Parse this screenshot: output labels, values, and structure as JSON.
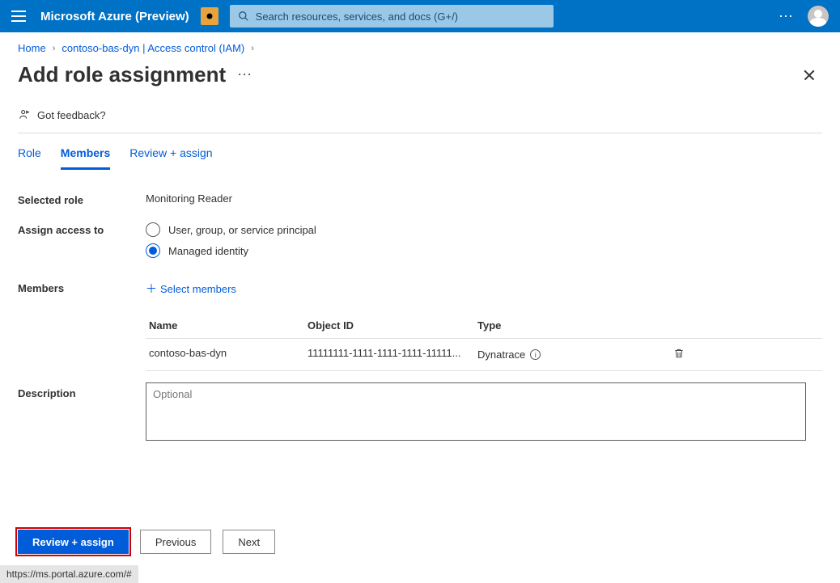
{
  "header": {
    "brand": "Microsoft Azure (Preview)",
    "search_placeholder": "Search resources, services, and docs (G+/)"
  },
  "breadcrumbs": {
    "items": [
      "Home",
      "contoso-bas-dyn | Access control (IAM)"
    ]
  },
  "page": {
    "title": "Add role assignment",
    "feedback": "Got feedback?"
  },
  "tabs": {
    "items": [
      {
        "label": "Role"
      },
      {
        "label": "Members"
      },
      {
        "label": "Review + assign"
      }
    ],
    "active_index": 1
  },
  "form": {
    "selected_role_label": "Selected role",
    "selected_role_value": "Monitoring Reader",
    "assign_access_label": "Assign access to",
    "assign_options": {
      "opt1": "User, group, or service principal",
      "opt2": "Managed identity"
    },
    "members_label": "Members",
    "select_members_link": "Select members",
    "table": {
      "headers": {
        "name": "Name",
        "object_id": "Object ID",
        "type": "Type"
      },
      "rows": [
        {
          "name": "contoso-bas-dyn",
          "object_id": "11111111-1111-1111-1111-11111...",
          "type": "Dynatrace"
        }
      ]
    },
    "description_label": "Description",
    "description_placeholder": "Optional"
  },
  "footer": {
    "primary": "Review + assign",
    "previous": "Previous",
    "next": "Next"
  },
  "status": {
    "url": "https://ms.portal.azure.com/#"
  }
}
